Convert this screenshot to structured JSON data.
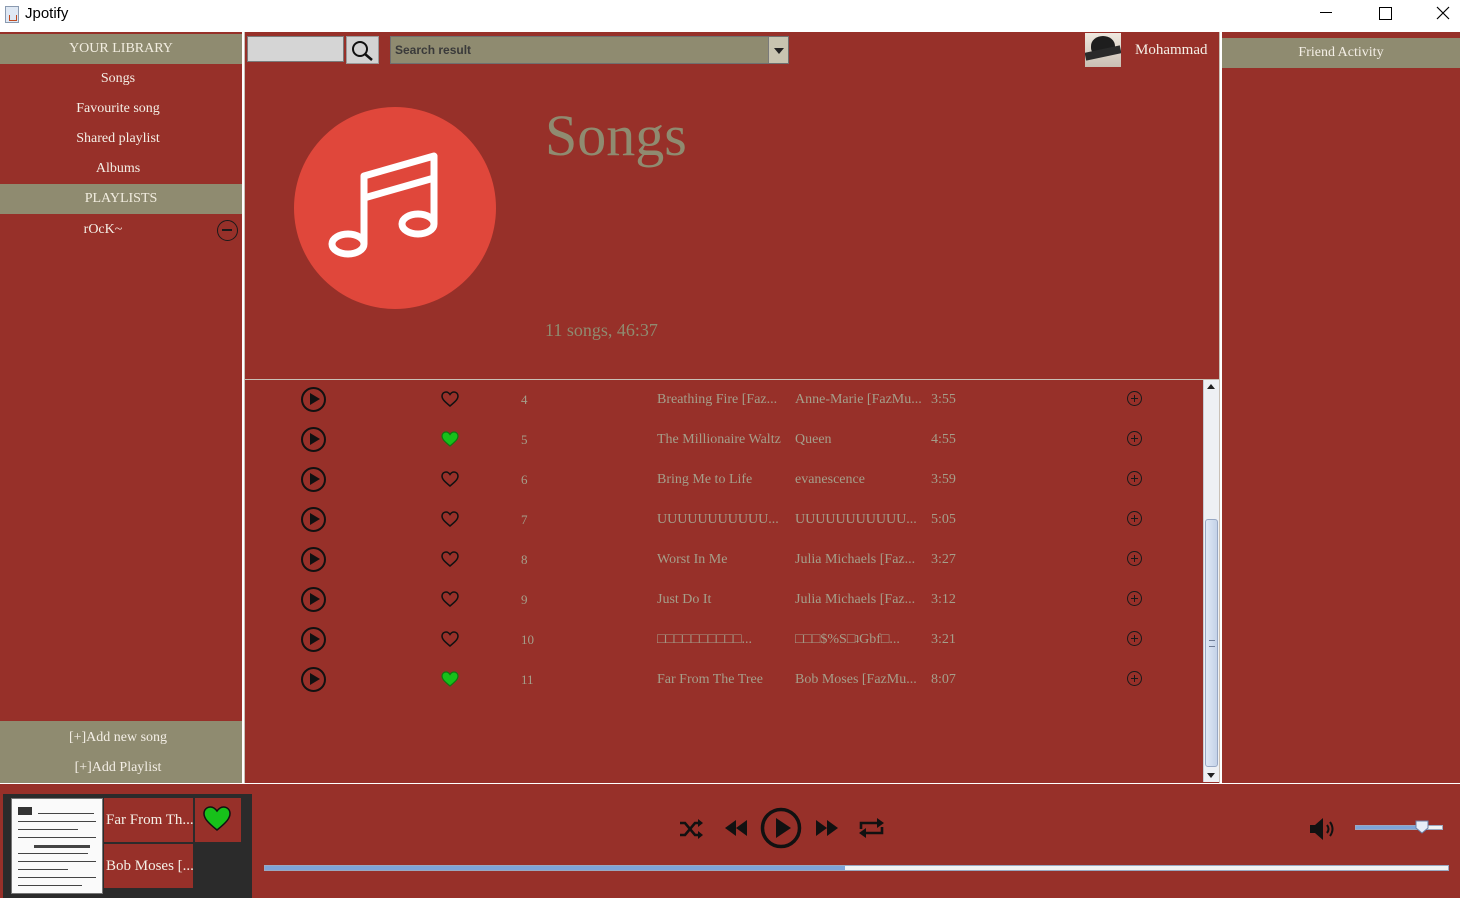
{
  "window": {
    "title": "Jpotify"
  },
  "sidebar": {
    "library_header": "YOUR LIBRARY",
    "library_items": [
      "Songs",
      "Favourite song",
      "Shared playlist",
      "Albums"
    ],
    "playlists_header": "PLAYLISTS",
    "playlists": [
      "rOcK~"
    ],
    "add_song": "[+]Add new song",
    "add_playlist": "[+]Add Playlist"
  },
  "search": {
    "placeholder": "",
    "results_label": "Search result"
  },
  "user": {
    "name": "Mohammad"
  },
  "header": {
    "title": "Songs",
    "stats": "11 songs, 46:37"
  },
  "songs": [
    {
      "number": "4",
      "title": "Breathing Fire [Faz...",
      "artist": "Anne-Marie [FazMu...",
      "duration": "3:55",
      "liked": false
    },
    {
      "number": "5",
      "title": "The Millionaire Waltz",
      "artist": "Queen",
      "duration": "4:55",
      "liked": true
    },
    {
      "number": "6",
      "title": "Bring Me to Life",
      "artist": "evanescence",
      "duration": "3:59",
      "liked": false
    },
    {
      "number": "7",
      "title": "UUUUUUUUUUU...",
      "artist": "UUUUUUUUUUU...",
      "duration": "5:05",
      "liked": false
    },
    {
      "number": "8",
      "title": "Worst In Me",
      "artist": "Julia Michaels [Faz...",
      "duration": "3:27",
      "liked": false
    },
    {
      "number": "9",
      "title": "Just Do It",
      "artist": "Julia Michaels [Faz...",
      "duration": "3:12",
      "liked": false
    },
    {
      "number": "10",
      "title": "□□□□□□□□□□...",
      "artist": "□□□$%S□ʇGbf□...",
      "duration": "3:21",
      "liked": false
    },
    {
      "number": "11",
      "title": "Far From The Tree",
      "artist": "Bob Moses [FazMu...",
      "duration": "8:07",
      "liked": true
    }
  ],
  "friends": {
    "header": "Friend Activity"
  },
  "now_playing": {
    "title": "Far From Th...",
    "artist": "Bob Moses [...",
    "liked": true
  },
  "player": {
    "progress": 0.49,
    "volume": 0.76
  },
  "colors": {
    "background": "#973029",
    "header_band": "#8f8b70",
    "cover": "#e0473b",
    "liked_heart": "#17c11a",
    "muted_text": "#a59e8a"
  },
  "icons": {
    "search": "magnifier-icon",
    "shuffle": "shuffle-icon",
    "previous": "rewind-icon",
    "play": "play-icon",
    "next": "fast-forward-icon",
    "repeat": "repeat-icon",
    "volume": "speaker-icon",
    "note": "music-note-icon"
  }
}
